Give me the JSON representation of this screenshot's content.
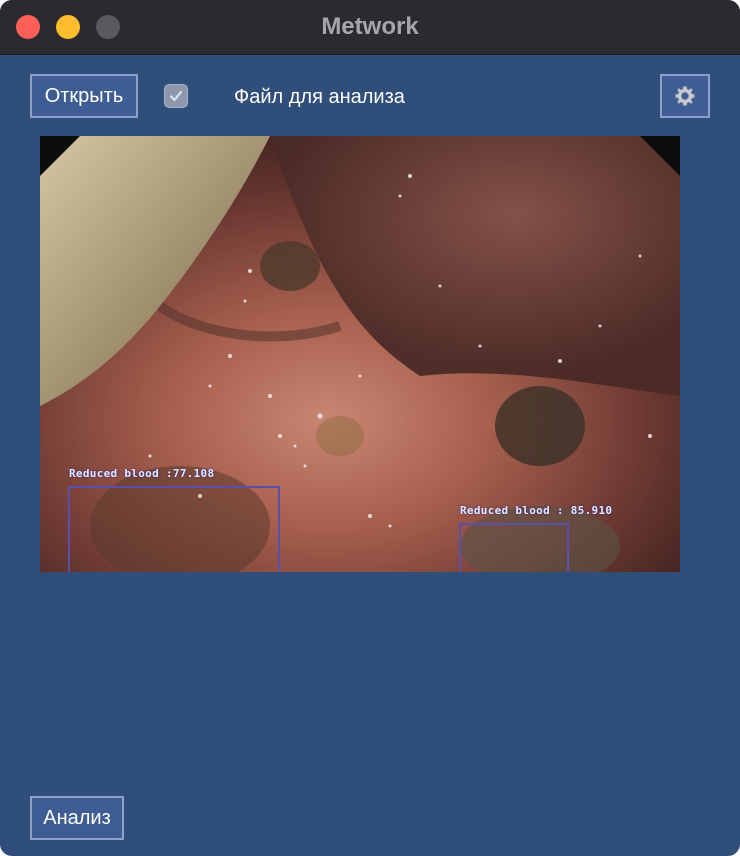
{
  "window": {
    "title": "Metwork"
  },
  "toolbar": {
    "open_label": "Открыть",
    "file_checkbox_checked": true,
    "file_label": "Файл для анализа",
    "settings_icon": "gear-icon"
  },
  "image": {
    "detections": [
      {
        "label": "Reduced blood :77.108"
      },
      {
        "label": "Reduced blood : 85.910"
      }
    ]
  },
  "footer": {
    "analyze_label": "Анализ"
  },
  "colors": {
    "background": "#2f4e7a",
    "titlebar": "#2b2a2e",
    "button": "#3e5d94",
    "detection_box": "#5a4fb0"
  }
}
